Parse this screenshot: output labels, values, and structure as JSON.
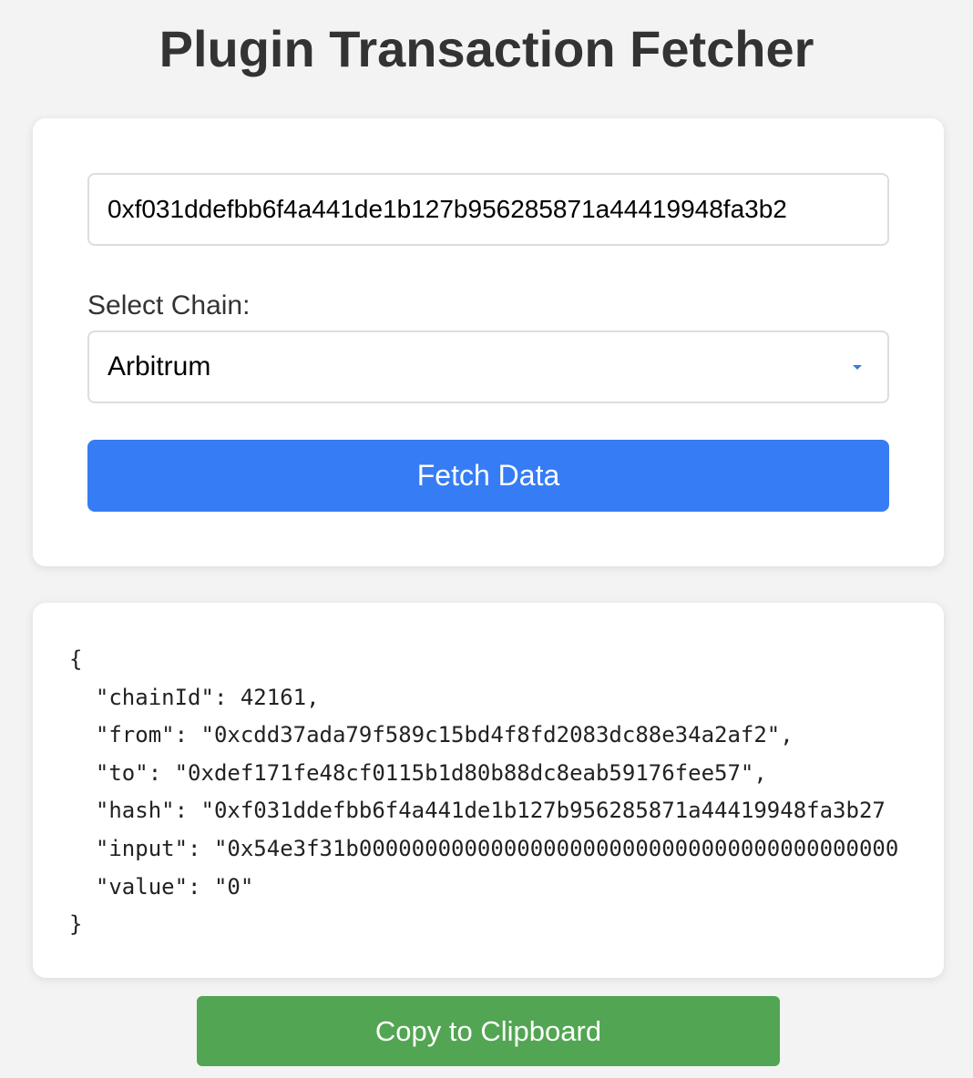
{
  "header": {
    "title": "Plugin Transaction Fetcher"
  },
  "form": {
    "hash_value": "0xf031ddefbb6f4a441de1b127b956285871a44419948fa3b2",
    "chain_label": "Select Chain:",
    "chain_selected": "Arbitrum",
    "fetch_label": "Fetch Data"
  },
  "output": {
    "lines": [
      "{",
      "  \"chainId\": 42161,",
      "  \"from\": \"0xcdd37ada79f589c15bd4f8fd2083dc88e34a2af2\",",
      "  \"to\": \"0xdef171fe48cf0115b1d80b88dc8eab59176fee57\",",
      "  \"hash\": \"0xf031ddefbb6f4a441de1b127b956285871a44419948fa3b27",
      "  \"input\": \"0x54e3f31b00000000000000000000000000000000000000000",
      "  \"value\": \"0\"",
      "}"
    ]
  },
  "actions": {
    "copy_label": "Copy to Clipboard"
  },
  "colors": {
    "background": "#f3f3f3",
    "card": "#ffffff",
    "fetch_button": "#367cf5",
    "copy_button": "#52a552",
    "select_arrow": "#3a7bd5"
  }
}
